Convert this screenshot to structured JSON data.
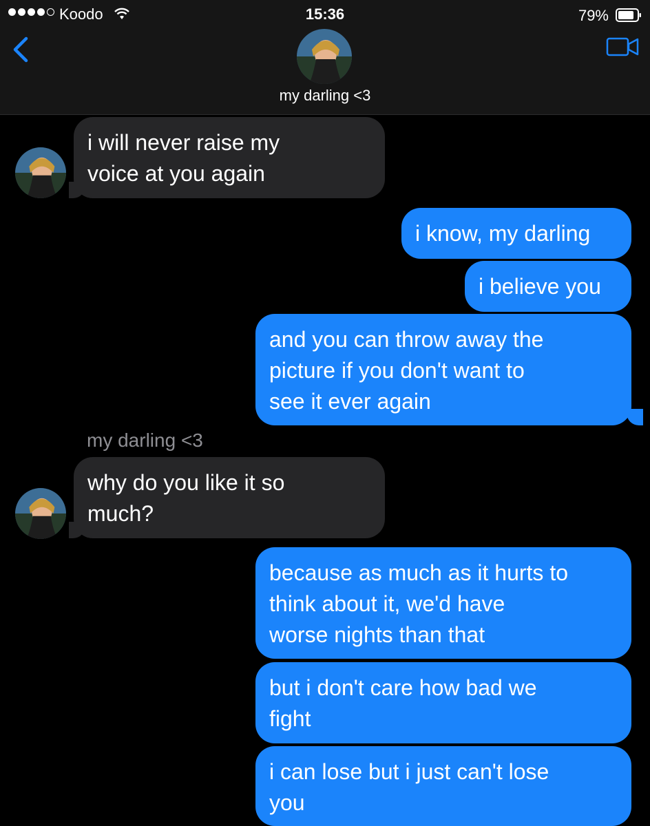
{
  "status_bar": {
    "carrier": "Koodo",
    "time": "15:36",
    "battery": "79%",
    "battery_level": 0.79
  },
  "header": {
    "back_icon": "chevron-left-icon",
    "contact_name": "my darling <3",
    "video_icon": "video-camera-icon"
  },
  "colors": {
    "accent": "#1b84fb",
    "incoming_bubble": "#262628",
    "header_bg": "#161616"
  },
  "sender_label": "my darling <3",
  "messages": [
    {
      "direction": "in",
      "text": "i will never raise my\nvoice at you again"
    },
    {
      "direction": "out",
      "text": "i know, my darling"
    },
    {
      "direction": "out",
      "text": "i believe you"
    },
    {
      "direction": "out",
      "text": "and you can throw away the\npicture if you don't want to\nsee it ever again"
    },
    {
      "direction": "in",
      "text": "why do you like it so\nmuch?"
    },
    {
      "direction": "out",
      "text": "because as much as it hurts to\nthink about it, we'd have\nworse nights than that"
    },
    {
      "direction": "out",
      "text": "but i don't care how bad we\nfight"
    },
    {
      "direction": "out",
      "text": "i can lose but i just can't lose\nyou"
    }
  ]
}
